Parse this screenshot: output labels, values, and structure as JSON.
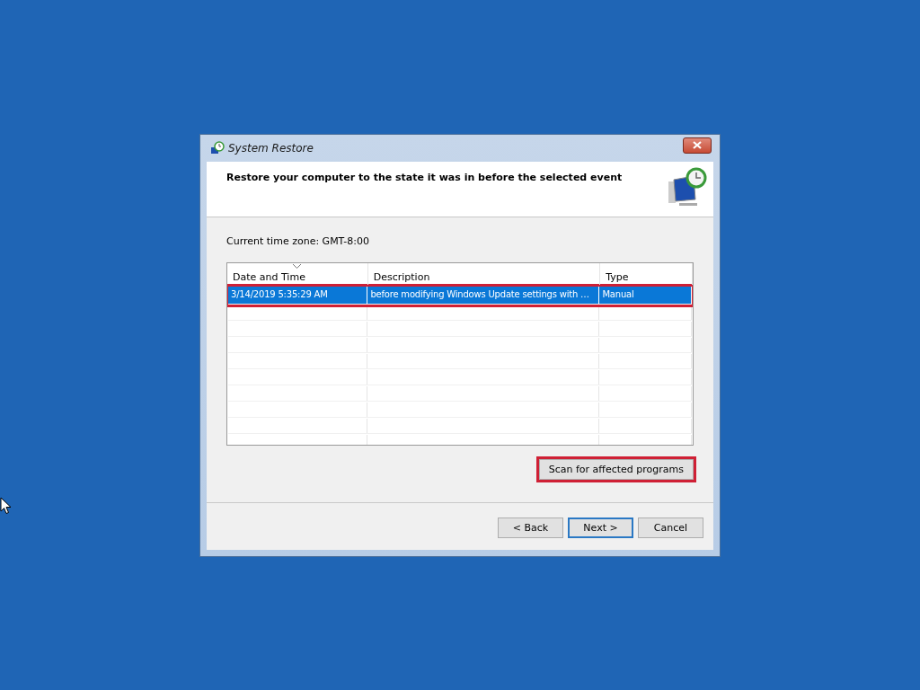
{
  "window": {
    "title": "System Restore"
  },
  "header": {
    "heading": "Restore your computer to the state it was in before the selected event"
  },
  "time_zone": "Current time zone: GMT-8:00",
  "table": {
    "columns": [
      {
        "label": "Date and Time",
        "sorted": true
      },
      {
        "label": "Description",
        "sorted": false
      },
      {
        "label": "Type",
        "sorted": false
      }
    ],
    "rows": [
      {
        "cells": [
          "3/14/2019 5:35:29 AM",
          "before modifying Windows Update settings with …",
          "Manual"
        ],
        "selected": true,
        "highlighted": true
      }
    ]
  },
  "scan_button": {
    "label": "Scan for affected programs",
    "highlighted": true
  },
  "buttons": [
    {
      "label": "< Back",
      "default": false
    },
    {
      "label": "Next >",
      "default": true
    },
    {
      "label": "Cancel",
      "default": false
    }
  ]
}
